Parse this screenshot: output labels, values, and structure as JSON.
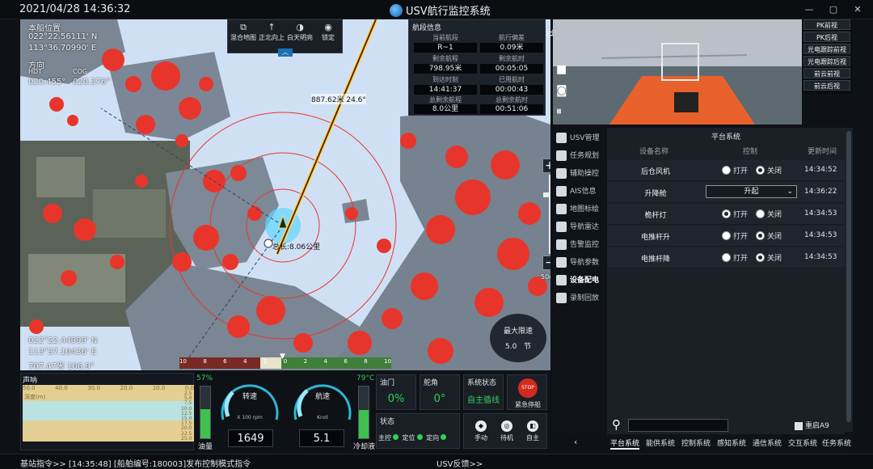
{
  "titlebar": {
    "datetime": "2021/04/28 14:36:32",
    "title": "USV航行监控系统"
  },
  "map": {
    "own_pos_label": "本船位置",
    "lat": "022°22.56111' N",
    "lon": "113°36.70990' E",
    "dir_label": "方向",
    "hdt_label": "HDT",
    "hdt": "020.455°",
    "cog_label": "COG",
    "cog": "020.376°",
    "cursor_lat": "022°22.44999' N",
    "cursor_lon": "113°37.10436' E",
    "cursor_dist": "707.47米  106.9°",
    "total_length": "总长:8.06公里",
    "bearing_label": "887.62米  24.6°",
    "scale": "50m",
    "max_speed_label": "最大限速",
    "max_speed_value": "5.0",
    "max_speed_unit": "节",
    "speedbar_ticks": [
      "10",
      "8",
      "6",
      "4",
      "2",
      "0",
      "2",
      "4",
      "6",
      "8",
      "10"
    ]
  },
  "toolbar": {
    "items": [
      {
        "label": "混合地图",
        "icon": "layers-icon"
      },
      {
        "label": "正北向上",
        "icon": "north-up-icon"
      },
      {
        "label": "白天明亮",
        "icon": "day-mode-icon"
      },
      {
        "label": "锁定",
        "icon": "lock-target-icon"
      }
    ]
  },
  "segment": {
    "title": "航段信息",
    "fields": [
      {
        "label": "当前航段",
        "value": "R~1"
      },
      {
        "label": "航行偏差",
        "value": "0.09米"
      },
      {
        "label": "剩余航程",
        "value": "798.95米"
      },
      {
        "label": "剩余航时",
        "value": "00:05:05"
      },
      {
        "label": "到达时刻",
        "value": "14:41:37"
      },
      {
        "label": "已用航时",
        "value": "00:00:43"
      },
      {
        "label": "总剩余航程",
        "value": "8.0公里"
      },
      {
        "label": "总剩余航时",
        "value": "00:51:06"
      }
    ]
  },
  "bottom": {
    "sonar_title": "声呐",
    "sonar_ticks": [
      "50.0",
      "40.0",
      "30.0",
      "20.0",
      "10.0",
      "0.0"
    ],
    "sonar_depth_label": "深度(m)",
    "sonar_y_ticks": [
      "2.5",
      "5.0",
      "7.5",
      "10.0",
      "12.5",
      "15.0",
      "17.5",
      "20.0",
      "22.5",
      "25.0"
    ],
    "fuel_pct": "57%",
    "fuel_level": 0.57,
    "fuel_label": "油量",
    "rpm_label": "转速",
    "rpm_unit": "X 100 rpm",
    "rpm_value": "1649",
    "speed_label": "航速",
    "speed_unit": "Knot",
    "speed_value": "5.1",
    "temp": "79°C",
    "temp_level": 0.55,
    "coolant_label": "冷却液",
    "throttle_label": "油门",
    "throttle_value": "0%",
    "rudder_label": "舵角",
    "rudder_value": "0°",
    "sys_state_label": "系统状态",
    "sys_state_value": "自主循线",
    "estop_label": "STOP",
    "estop_caption": "紧急停船",
    "state_label": "状态",
    "state_items": [
      "主控",
      "定位",
      "定向"
    ],
    "mode_buttons": [
      {
        "label": "手动",
        "icon": "manual-icon"
      },
      {
        "label": "待机",
        "icon": "standby-icon"
      },
      {
        "label": "自主",
        "icon": "auto-icon"
      }
    ]
  },
  "statusbar": {
    "left": "基站指令>> [14:35:48] [船舶编号:180003]发布控制模式指令",
    "middle": "USV反馈>>"
  },
  "camera_modes": [
    "PK前视",
    "PK后视",
    "光电跟踪前视",
    "光电跟踪后视",
    "前云前视",
    "前云后视"
  ],
  "sidenav": [
    {
      "label": "USV管理",
      "icon": "usv-icon"
    },
    {
      "label": "任务规划",
      "icon": "mission-icon"
    },
    {
      "label": "辅助操控",
      "icon": "assist-icon"
    },
    {
      "label": "AIS信息",
      "icon": "ais-icon"
    },
    {
      "label": "地图标绘",
      "icon": "map-draw-icon"
    },
    {
      "label": "导航雷达",
      "icon": "radar-icon"
    },
    {
      "label": "告警监控",
      "icon": "alarm-icon"
    },
    {
      "label": "导航参数",
      "icon": "nav-param-icon"
    },
    {
      "label": "设备配电",
      "icon": "power-icon"
    },
    {
      "label": "录制回放",
      "icon": "record-icon"
    }
  ],
  "platform": {
    "title": "平台系统",
    "col_name": "设备名称",
    "col_ctrl": "控制",
    "col_time": "更新时间",
    "on_label": "打开",
    "off_label": "关闭",
    "rows": [
      {
        "name": "后仓风机",
        "time": "14:34:52",
        "state": "off"
      },
      {
        "name": "升降舱",
        "time": "14:36:22",
        "select": "升起"
      },
      {
        "name": "桅杆灯",
        "time": "14:34:53",
        "state": "on"
      },
      {
        "name": "电推杆升",
        "time": "14:34:53",
        "state": "off"
      },
      {
        "name": "电推杆降",
        "time": "14:34:53",
        "state": "off"
      }
    ],
    "restart_label": "重启A9"
  },
  "tabs": [
    "平台系统",
    "能供系统",
    "控制系统",
    "感知系统",
    "通信系统",
    "交互系统",
    "任务系统"
  ],
  "colors": {
    "accent_green": "#31d05b",
    "land_red": "#e8352b",
    "water": "#cfe0f5",
    "track_yellow": "#f3e04a"
  }
}
